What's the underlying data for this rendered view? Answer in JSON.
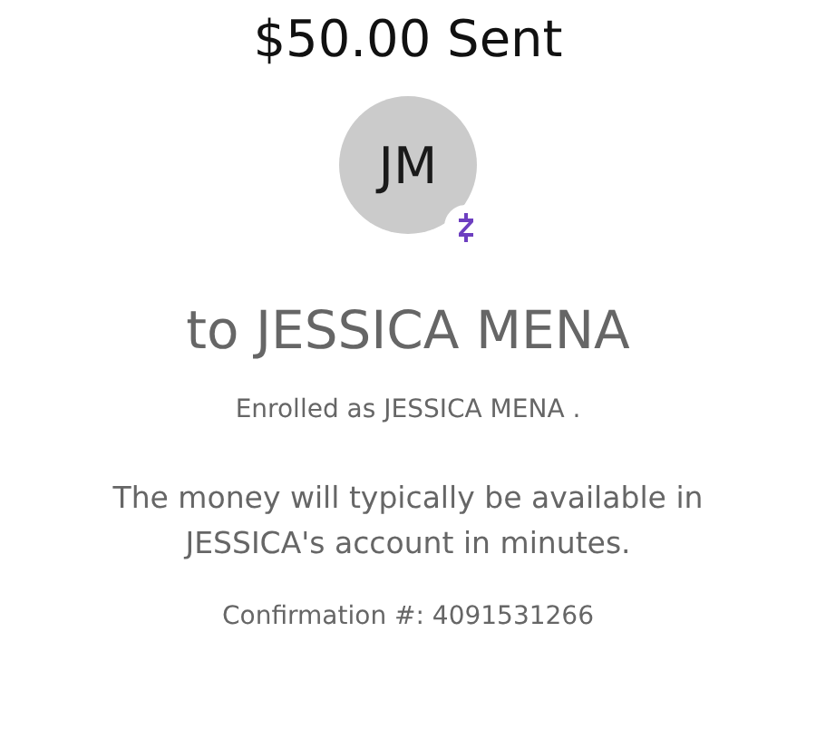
{
  "title": "$50.00 Sent",
  "recipient": {
    "initials": "JM",
    "heading": "to JESSICA MENA"
  },
  "enrollment": "Enrolled as JESSICA MENA .",
  "message": "The money will typically be available in JESSICA's account in minutes.",
  "confirmation": "Confirmation #: 4091531266"
}
